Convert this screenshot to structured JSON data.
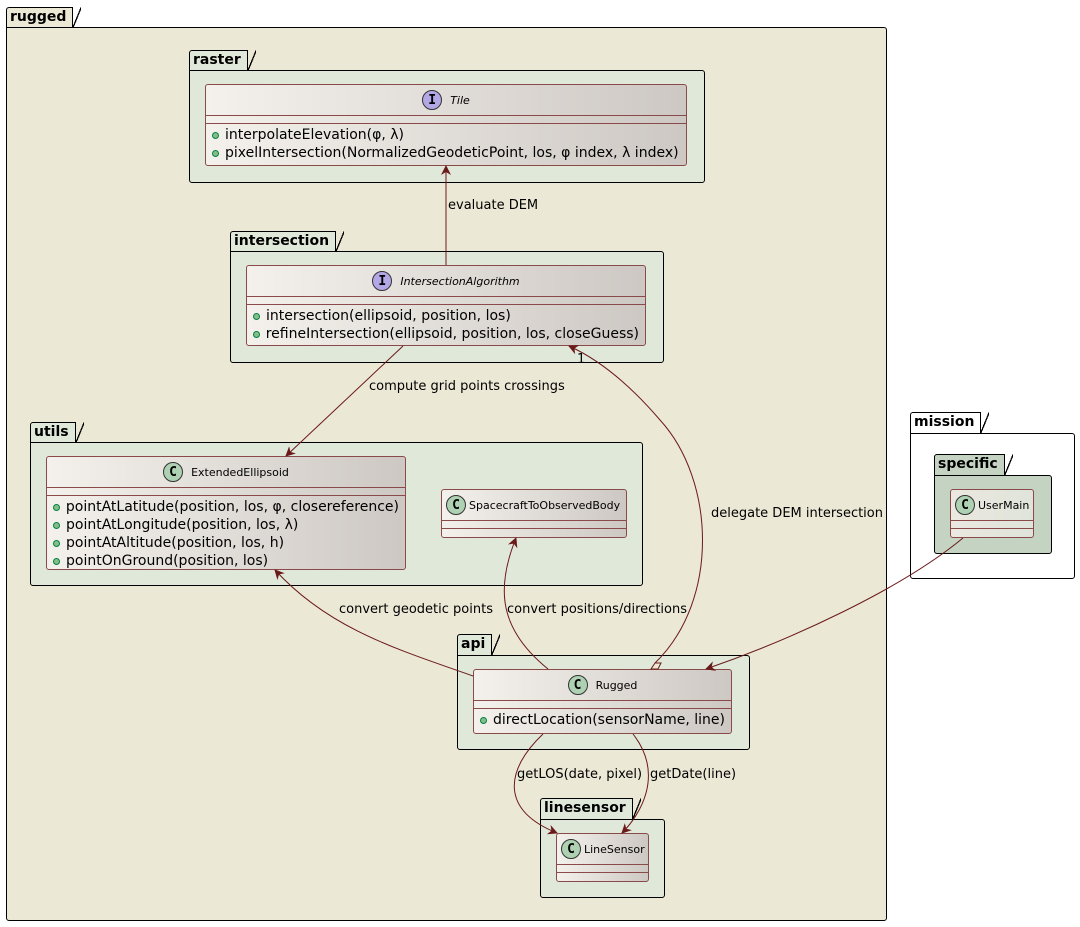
{
  "packages": {
    "rugged": "rugged",
    "raster": "raster",
    "intersection": "intersection",
    "utils": "utils",
    "api": "api",
    "linesensor": "linesensor",
    "mission": "mission",
    "specific": "specific"
  },
  "classes": {
    "tile": {
      "name": "Tile",
      "stereotype_icon": "interface-icon",
      "badge": "I",
      "methods": [
        "interpolateElevation(φ, λ)",
        "pixelIntersection(NormalizedGeodeticPoint, los, φ index, λ index)"
      ]
    },
    "intersection_algorithm": {
      "name": "IntersectionAlgorithm",
      "stereotype_icon": "interface-icon",
      "badge": "I",
      "methods": [
        "intersection(ellipsoid, position, los)",
        "refineIntersection(ellipsoid, position, los, closeGuess)"
      ]
    },
    "extended_ellipsoid": {
      "name": "ExtendedEllipsoid",
      "stereotype_icon": "class-icon",
      "badge": "C",
      "methods": [
        "pointAtLatitude(position, los, φ, closereference)",
        "pointAtLongitude(position, los, λ)",
        "pointAtAltitude(position, los, h)",
        "pointOnGround(position, los)"
      ]
    },
    "spacecraft_to_observed_body": {
      "name": "SpacecraftToObservedBody",
      "stereotype_icon": "class-icon",
      "badge": "C",
      "methods": []
    },
    "rugged": {
      "name": "Rugged",
      "stereotype_icon": "class-icon",
      "badge": "C",
      "methods": [
        "directLocation(sensorName, line)"
      ]
    },
    "line_sensor": {
      "name": "LineSensor",
      "stereotype_icon": "class-icon",
      "badge": "C",
      "methods": []
    },
    "user_main": {
      "name": "UserMain",
      "stereotype_icon": "class-icon",
      "badge": "C",
      "methods": []
    }
  },
  "relations": [
    {
      "from": "IntersectionAlgorithm",
      "to": "Tile",
      "label": "evaluate DEM"
    },
    {
      "from": "IntersectionAlgorithm",
      "to": "ExtendedEllipsoid",
      "label": "compute grid points crossings"
    },
    {
      "from": "Rugged",
      "to": "IntersectionAlgorithm",
      "label": "delegate DEM intersection",
      "multiplicity": "1",
      "type": "aggregation"
    },
    {
      "from": "Rugged",
      "to": "ExtendedEllipsoid",
      "label": "convert geodetic points"
    },
    {
      "from": "Rugged",
      "to": "SpacecraftToObservedBody",
      "label": "convert positions/directions"
    },
    {
      "from": "Rugged",
      "to": "LineSensor",
      "label": "getLOS(date, pixel)"
    },
    {
      "from": "Rugged",
      "to": "LineSensor",
      "label": "getDate(line)"
    },
    {
      "from": "UserMain",
      "to": "Rugged",
      "label": ""
    }
  ],
  "colors": {
    "outer_package": "#ebe8d6",
    "inner_package": "#dfe8d9",
    "specific_package": "#c4d3c2",
    "arrow": "#6b1a1a",
    "class_border": "#8b4a4a"
  }
}
